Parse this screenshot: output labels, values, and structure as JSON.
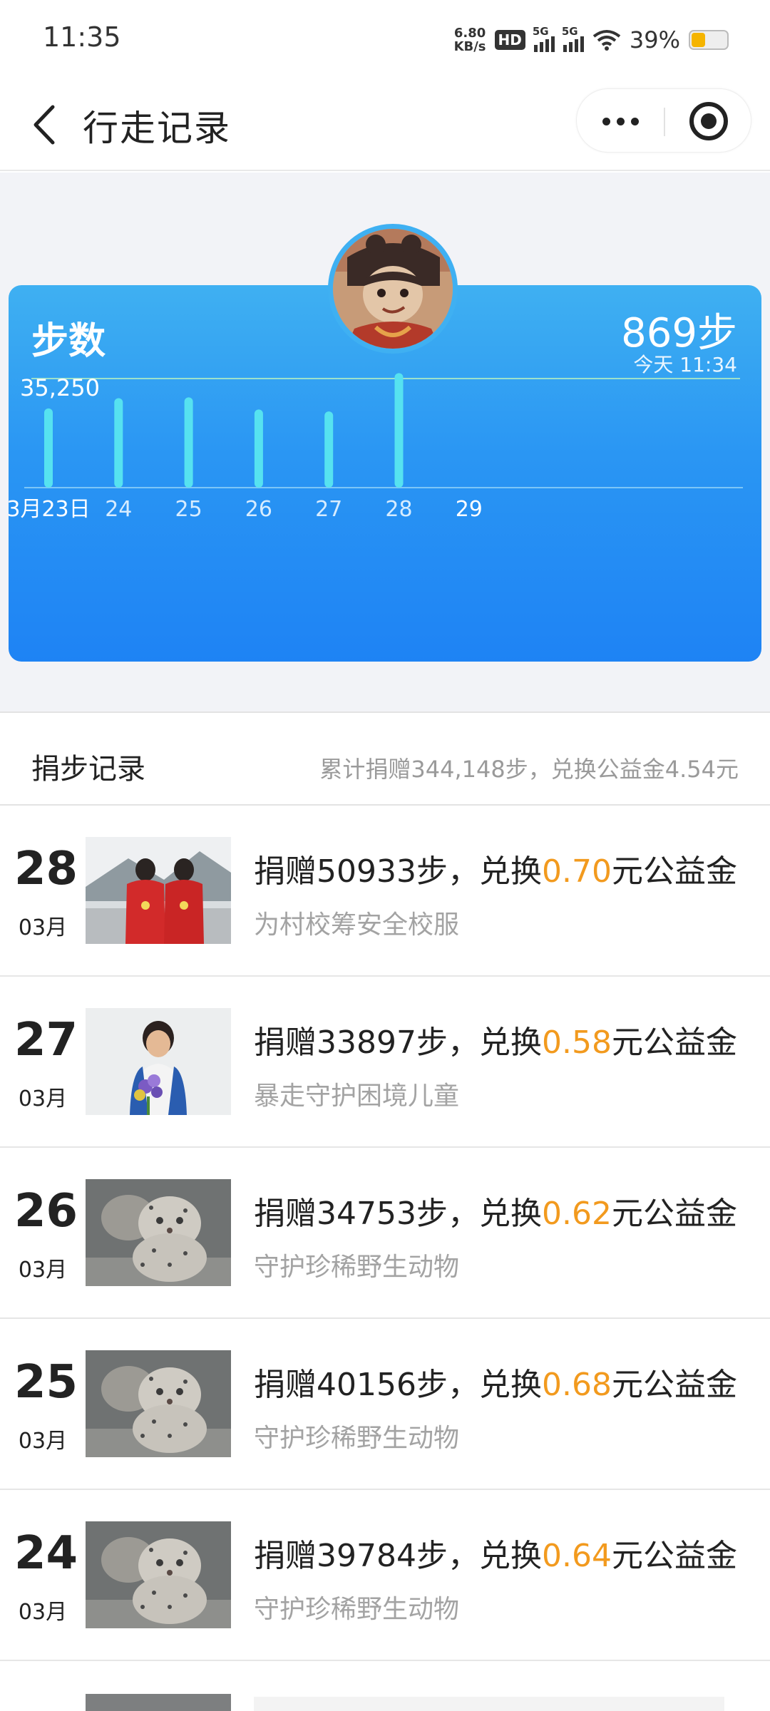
{
  "status_bar": {
    "time": "11:35",
    "net_speed_value": "6.80",
    "net_speed_unit": "KB/s",
    "hd_label": "HD",
    "signal1_label": "5G",
    "signal2_label": "5G",
    "battery_percent": "39%",
    "battery_level": 0.39,
    "battery_color": "#f5b400"
  },
  "header": {
    "title": "行走记录",
    "back_icon": "chevron-left-icon",
    "more_icon": "more-dots-icon",
    "close_icon": "target-circle-icon"
  },
  "step_card": {
    "title": "步数",
    "steps_today": "869步",
    "updated": "今天 11:34",
    "accent": "#1e83f4"
  },
  "chart_data": {
    "type": "bar",
    "categories": [
      "3月23日",
      "24",
      "25",
      "26",
      "27",
      "28",
      "29"
    ],
    "values": [
      35250,
      39784,
      40156,
      34753,
      33897,
      50933,
      869
    ],
    "highlight_label": "35,250",
    "ylim": [
      0,
      52000
    ],
    "bar_color": "#56e2f0"
  },
  "donation": {
    "title": "捐步记录",
    "summary": "累计捐赠344,148步，兑换公益金4.54元"
  },
  "records": [
    {
      "day": "28",
      "month": "03月",
      "prefix": "捐赠50933步，兑换",
      "amount": "0.70",
      "suffix": "元公益金",
      "project": "为村校筹安全校服",
      "image": "children-red-jackets"
    },
    {
      "day": "27",
      "month": "03月",
      "prefix": "捐赠33897步，兑换",
      "amount": "0.58",
      "suffix": "元公益金",
      "project": "暴走守护困境儿童",
      "image": "girl-with-flowers"
    },
    {
      "day": "26",
      "month": "03月",
      "prefix": "捐赠34753步，兑换",
      "amount": "0.62",
      "suffix": "元公益金",
      "project": "守护珍稀野生动物",
      "image": "snow-leopard-cub"
    },
    {
      "day": "25",
      "month": "03月",
      "prefix": "捐赠40156步，兑换",
      "amount": "0.68",
      "suffix": "元公益金",
      "project": "守护珍稀野生动物",
      "image": "snow-leopard-cub"
    },
    {
      "day": "24",
      "month": "03月",
      "prefix": "捐赠39784步，兑换",
      "amount": "0.64",
      "suffix": "元公益金",
      "project": "守护珍稀野生动物",
      "image": "snow-leopard-cub"
    }
  ]
}
